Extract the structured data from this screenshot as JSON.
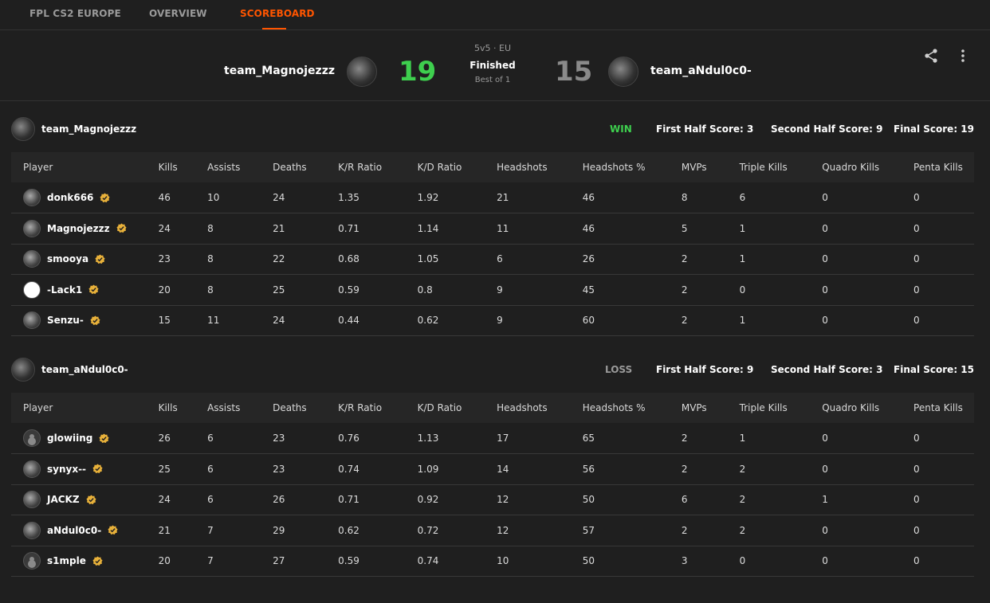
{
  "nav": {
    "tabs": [
      {
        "label": "FPL CS2 EUROPE",
        "active": false
      },
      {
        "label": "OVERVIEW",
        "active": false
      },
      {
        "label": "SCOREBOARD",
        "active": true
      }
    ]
  },
  "match": {
    "team1": {
      "name": "team_Magnojezzz",
      "score": "19",
      "score_color": "#3ecf4e"
    },
    "team2": {
      "name": "team_aNdul0c0-",
      "score": "15",
      "score_color": "#8a8a8a"
    },
    "format": "5v5 · EU",
    "status": "Finished",
    "best_of": "Best of 1",
    "share_icon": "share-icon",
    "more_icon": "more-vertical-icon"
  },
  "teams": [
    {
      "name": "team_Magnojezzz",
      "result": "WIN",
      "result_color": "#3ecf4e",
      "first_half": "First Half Score: 3",
      "second_half": "Second Half Score: 9",
      "final": "Final Score: 19",
      "players": [
        {
          "name": "donk666",
          "kills": "46",
          "assists": "10",
          "deaths": "24",
          "kr": "1.35",
          "kd": "1.92",
          "hs": "21",
          "hsp": "46",
          "mvps": "8",
          "triple": "6",
          "quadro": "0",
          "penta": "0"
        },
        {
          "name": "Magnojezzz",
          "kills": "24",
          "assists": "8",
          "deaths": "21",
          "kr": "0.71",
          "kd": "1.14",
          "hs": "11",
          "hsp": "46",
          "mvps": "5",
          "triple": "1",
          "quadro": "0",
          "penta": "0"
        },
        {
          "name": "smooya",
          "kills": "23",
          "assists": "8",
          "deaths": "22",
          "kr": "0.68",
          "kd": "1.05",
          "hs": "6",
          "hsp": "26",
          "mvps": "2",
          "triple": "1",
          "quadro": "0",
          "penta": "0"
        },
        {
          "name": "-Lack1",
          "kills": "20",
          "assists": "8",
          "deaths": "25",
          "kr": "0.59",
          "kd": "0.8",
          "hs": "9",
          "hsp": "45",
          "mvps": "2",
          "triple": "0",
          "quadro": "0",
          "penta": "0"
        },
        {
          "name": "Senzu-",
          "kills": "15",
          "assists": "11",
          "deaths": "24",
          "kr": "0.44",
          "kd": "0.62",
          "hs": "9",
          "hsp": "60",
          "mvps": "2",
          "triple": "1",
          "quadro": "0",
          "penta": "0"
        }
      ]
    },
    {
      "name": "team_aNdul0c0-",
      "result": "LOSS",
      "result_color": "#9a9a9a",
      "first_half": "First Half Score: 9",
      "second_half": "Second Half Score: 3",
      "final": "Final Score: 15",
      "players": [
        {
          "name": "glowiing",
          "kills": "26",
          "assists": "6",
          "deaths": "23",
          "kr": "0.76",
          "kd": "1.13",
          "hs": "17",
          "hsp": "65",
          "mvps": "2",
          "triple": "1",
          "quadro": "0",
          "penta": "0"
        },
        {
          "name": "synyx--",
          "kills": "25",
          "assists": "6",
          "deaths": "23",
          "kr": "0.74",
          "kd": "1.09",
          "hs": "14",
          "hsp": "56",
          "mvps": "2",
          "triple": "2",
          "quadro": "0",
          "penta": "0"
        },
        {
          "name": "JACKZ",
          "kills": "24",
          "assists": "6",
          "deaths": "26",
          "kr": "0.71",
          "kd": "0.92",
          "hs": "12",
          "hsp": "50",
          "mvps": "6",
          "triple": "2",
          "quadro": "1",
          "penta": "0"
        },
        {
          "name": "aNdul0c0-",
          "kills": "21",
          "assists": "7",
          "deaths": "29",
          "kr": "0.62",
          "kd": "0.72",
          "hs": "12",
          "hsp": "57",
          "mvps": "2",
          "triple": "2",
          "quadro": "0",
          "penta": "0"
        },
        {
          "name": "s1mple",
          "kills": "20",
          "assists": "7",
          "deaths": "27",
          "kr": "0.59",
          "kd": "0.74",
          "hs": "10",
          "hsp": "50",
          "mvps": "3",
          "triple": "0",
          "quadro": "0",
          "penta": "0"
        }
      ]
    }
  ],
  "columns": [
    "Player",
    "Kills",
    "Assists",
    "Deaths",
    "K/R Ratio",
    "K/D Ratio",
    "Headshots",
    "Headshots %",
    "MVPs",
    "Triple Kills",
    "Quadro Kills",
    "Penta Kills"
  ],
  "icons": {
    "verified": "verified-badge-icon",
    "accent": "#ff5500",
    "badge_color": "#e8b13a"
  }
}
